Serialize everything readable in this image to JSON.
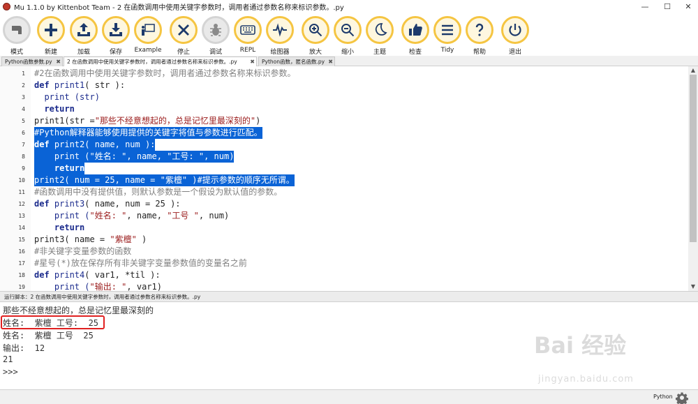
{
  "window": {
    "title": "Mu 1.1.0 by Kittenbot Team - 2 在函数调用中使用关键字参数时，调用者通过参数名称来标识参数。.py",
    "minimize": "—",
    "maximize": "☐",
    "close": "✕"
  },
  "toolbar": [
    {
      "label": "模式",
      "icon": "mode-icon"
    },
    {
      "label": "新建",
      "icon": "plus-icon"
    },
    {
      "label": "加载",
      "icon": "upload-icon"
    },
    {
      "label": "保存",
      "icon": "download-icon"
    },
    {
      "label": "Example",
      "icon": "presentation-icon"
    },
    {
      "label": "停止",
      "icon": "stop-icon"
    },
    {
      "label": "调试",
      "icon": "bug-icon"
    },
    {
      "label": "REPL",
      "icon": "keyboard-icon"
    },
    {
      "label": "绘图器",
      "icon": "plotter-icon"
    },
    {
      "label": "放大",
      "icon": "zoom-in-icon"
    },
    {
      "label": "缩小",
      "icon": "zoom-out-icon"
    },
    {
      "label": "主题",
      "icon": "moon-icon"
    },
    {
      "label": "检查",
      "icon": "thumbs-up-icon"
    },
    {
      "label": "Tidy",
      "icon": "tidy-icon"
    },
    {
      "label": "帮助",
      "icon": "help-icon"
    },
    {
      "label": "退出",
      "icon": "power-icon"
    }
  ],
  "tabs": [
    {
      "label": "Python函数参数.py",
      "close": "✖"
    },
    {
      "label": "2 在函数调用中使用关键字参数时，调用者通过参数名称来标识参数。.py",
      "close": "✖"
    },
    {
      "label": "Python函数，匿名函数.py",
      "close": "✖"
    }
  ],
  "editor": {
    "line_numbers": [
      "1",
      "2",
      "3",
      "4",
      "5",
      "6",
      "7",
      "8",
      "9",
      "10",
      "11",
      "12",
      "13",
      "14",
      "15",
      "16",
      "17",
      "18",
      "19"
    ],
    "lines": [
      [
        {
          "t": "#2在函数调用中使用关键字参数时，调用者通过参数名称来标识参数。",
          "c": "cm"
        }
      ],
      [
        {
          "t": "def ",
          "c": "kw"
        },
        {
          "t": "print1",
          "c": "fn"
        },
        {
          "t": "( str ):",
          "c": ""
        }
      ],
      [
        {
          "t": "  print (str)",
          "c": "fn"
        }
      ],
      [
        {
          "t": "  return",
          "c": "kw"
        }
      ],
      [
        {
          "t": "print1(str =",
          "c": ""
        },
        {
          "t": "\"那些不经意想起的，总是记忆里最深刻的\"",
          "c": "str"
        },
        {
          "t": ")",
          "c": ""
        }
      ],
      [
        {
          "t": "#Python解释器能够使用提供的关键字将值与参数进行匹配。",
          "c": "cm"
        }
      ],
      [
        {
          "t": "def ",
          "c": "kw"
        },
        {
          "t": "print2",
          "c": "fn"
        },
        {
          "t": "( name, num ):",
          "c": ""
        }
      ],
      [
        {
          "t": "    print (",
          "c": "fn"
        },
        {
          "t": "\"姓名: \"",
          "c": "str"
        },
        {
          "t": ", name, ",
          "c": ""
        },
        {
          "t": "\"工号: \"",
          "c": "str"
        },
        {
          "t": ", num)",
          "c": ""
        }
      ],
      [
        {
          "t": "    return",
          "c": "kw"
        }
      ],
      [
        {
          "t": "print2( num = 25, name = ",
          "c": ""
        },
        {
          "t": "\"紫檀\"",
          "c": "str"
        },
        {
          "t": " )",
          "c": ""
        },
        {
          "t": "#提示参数的顺序无所谓。",
          "c": "cm"
        }
      ],
      [
        {
          "t": "#函数调用中没有提供值，则默认参数是一个假设为默认值的参数。",
          "c": "cm"
        }
      ],
      [
        {
          "t": "def ",
          "c": "kw"
        },
        {
          "t": "print3",
          "c": "fn"
        },
        {
          "t": "( name, num = 25 ):",
          "c": ""
        }
      ],
      [
        {
          "t": "    print (",
          "c": "fn"
        },
        {
          "t": "\"姓名: \"",
          "c": "str"
        },
        {
          "t": ", name, ",
          "c": ""
        },
        {
          "t": "\"工号 \"",
          "c": "str"
        },
        {
          "t": ", num)",
          "c": ""
        }
      ],
      [
        {
          "t": "    return",
          "c": "kw"
        }
      ],
      [
        {
          "t": "print3( name = ",
          "c": ""
        },
        {
          "t": "\"紫檀\"",
          "c": "str"
        },
        {
          "t": " )",
          "c": ""
        }
      ],
      [
        {
          "t": "#非关键字变量参数的函数",
          "c": "cm"
        }
      ],
      [
        {
          "t": "#星号(*)放在保存所有非关键字变量参数值的变量名之前",
          "c": "cm"
        }
      ],
      [
        {
          "t": "def ",
          "c": "kw"
        },
        {
          "t": "print4",
          "c": "fn"
        },
        {
          "t": "( var1, *til ):",
          "c": ""
        }
      ],
      [
        {
          "t": "    print (",
          "c": "fn"
        },
        {
          "t": "\"输出: \"",
          "c": "str"
        },
        {
          "t": ", var1)",
          "c": ""
        }
      ]
    ],
    "selected_lines": [
      6,
      7,
      8,
      9,
      10
    ]
  },
  "runner": {
    "title": "运行脚本：2 在函数调用中使用关键字参数时，调用者通过参数名称来标识参数。.py",
    "output": [
      "那些不经意想起的，总是记忆里最深刻的",
      "姓名:  紫檀 工号:  25",
      "姓名:  紫檀 工号  25",
      "输出:  12",
      "21",
      ">>>"
    ]
  },
  "watermark": {
    "logo": "Bai 经验",
    "url": "jingyan.baidu.com"
  },
  "status": {
    "mode": "Python",
    "settings_icon": "gear-icon"
  },
  "colors": {
    "accent": "#f5c542",
    "selection": "#0a63d6",
    "highlight_box": "#e02020"
  }
}
